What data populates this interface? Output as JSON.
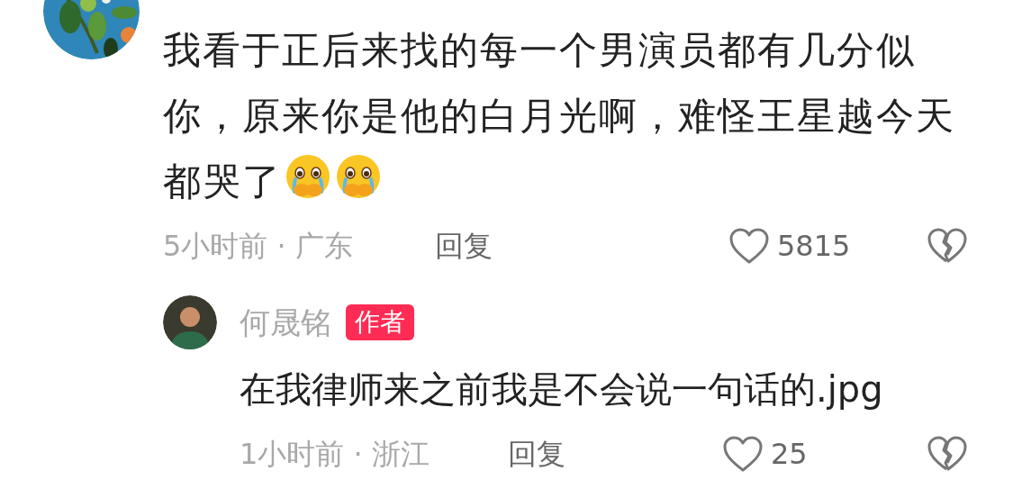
{
  "comment": {
    "text": "我看于正后来找的每一个男演员都有几分似你，原来你是他的白月光啊，难怪王星越今天都哭了",
    "emojis": [
      {
        "kind": "crying"
      },
      {
        "kind": "crying"
      }
    ],
    "time_location": "5小时前 · 广东",
    "reply_button": "回复",
    "likes": "5815",
    "reply": {
      "author": "何晟铭",
      "badge": "作者",
      "text": "在我律师来之前我是不会说一句话的.jpg",
      "time_location": "1小时前 · 浙江",
      "reply_button": "回复",
      "likes": "25"
    }
  }
}
